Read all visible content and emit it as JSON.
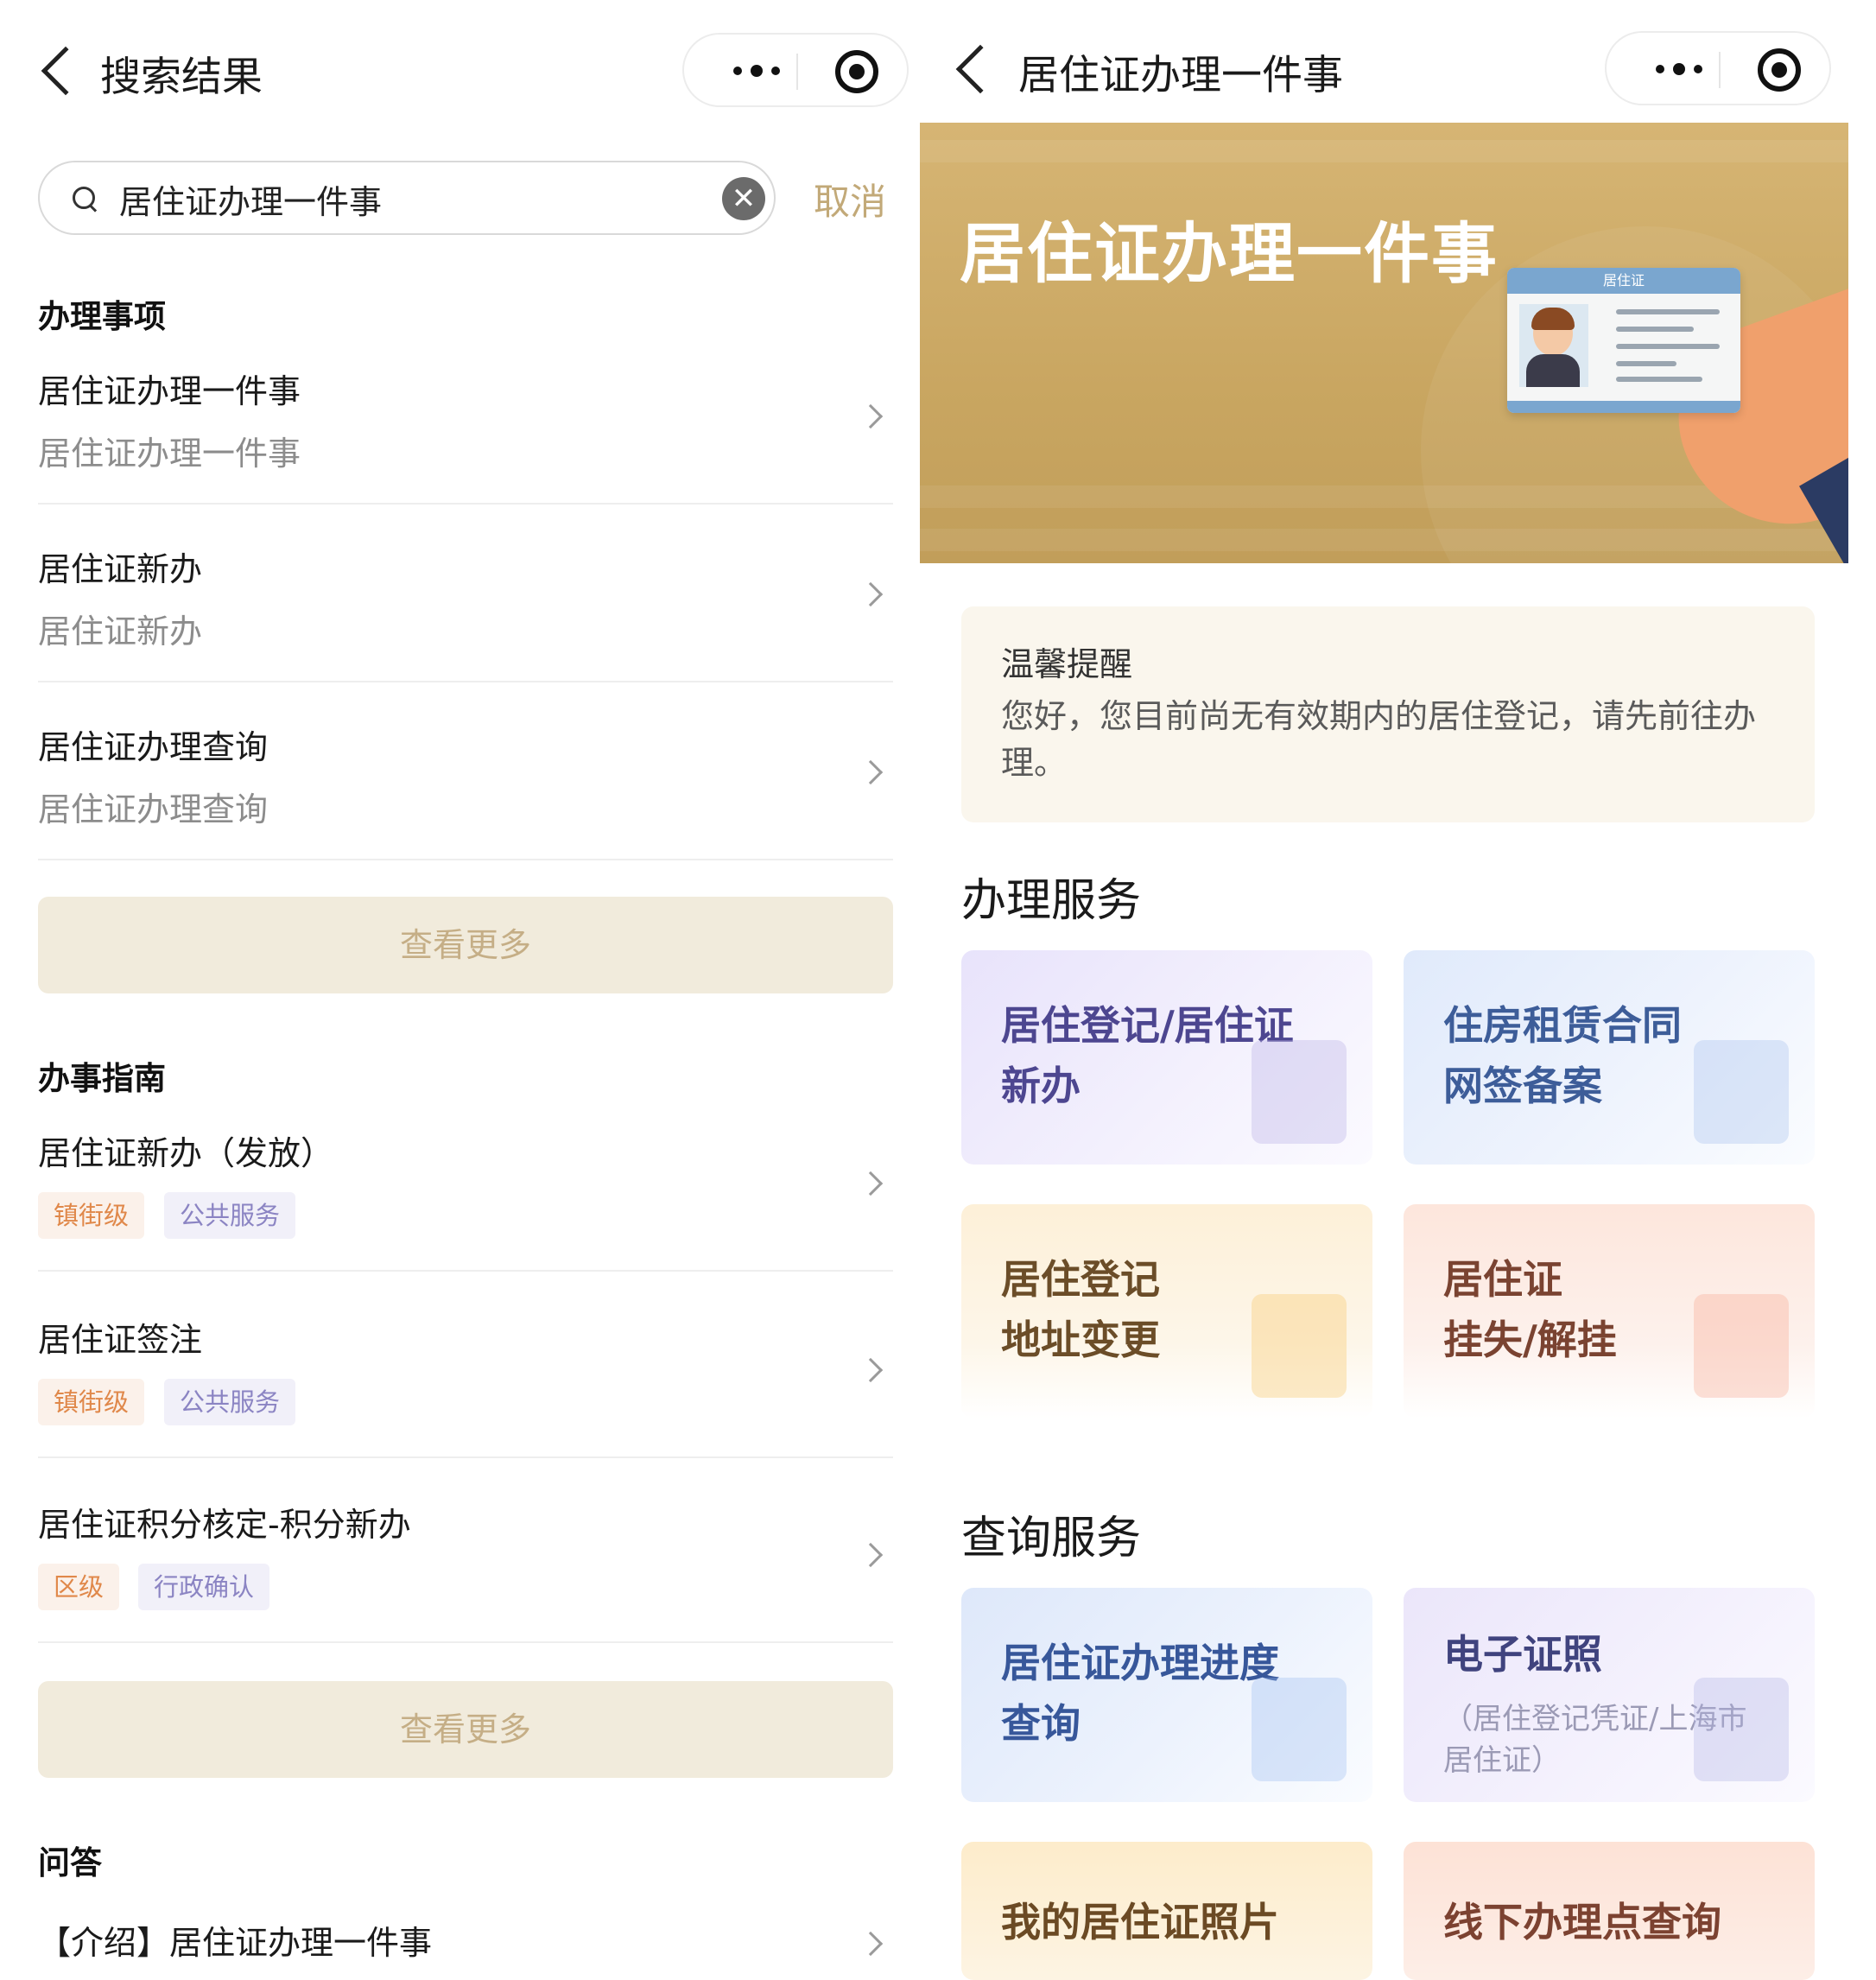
{
  "left": {
    "nav": {
      "title": "搜索结果"
    },
    "search": {
      "value": "居住证办理一件事",
      "cancel": "取消"
    },
    "sections": {
      "items_title": "办理事项",
      "guide_title": "办事指南",
      "qa_title": "问答"
    },
    "items": [
      {
        "title": "居住证办理一件事",
        "subtitle": "居住证办理一件事"
      },
      {
        "title": "居住证新办",
        "subtitle": "居住证新办"
      },
      {
        "title": "居住证办理查询",
        "subtitle": "居住证办理查询"
      }
    ],
    "guides": [
      {
        "title": "居住证新办（发放）",
        "tag1": "镇街级",
        "tag2": "公共服务"
      },
      {
        "title": "居住证签注",
        "tag1": "镇街级",
        "tag2": "公共服务"
      },
      {
        "title": "居住证积分核定-积分新办",
        "tag1": "区级",
        "tag2": "行政确认"
      }
    ],
    "more_label": "查看更多",
    "qa": [
      {
        "title": "【介绍】居住证办理一件事"
      }
    ]
  },
  "right": {
    "nav": {
      "title": "居住证办理一件事"
    },
    "banner": {
      "title": "居住证办理一件事",
      "card_header": "居住证"
    },
    "notice": {
      "title": "温馨提醒",
      "body": "您好，您目前尚无有效期内的居住登记，请先前往办理。"
    },
    "handle_section": "办理服务",
    "query_section": "查询服务",
    "handle_cards": [
      {
        "label": "居住登记/居住证\n新办"
      },
      {
        "label": "住房租赁合同\n网签备案"
      },
      {
        "label": "居住登记\n地址变更"
      },
      {
        "label": "居住证\n挂失/解挂"
      }
    ],
    "query_cards": [
      {
        "label": "居住证办理进度\n查询"
      },
      {
        "label": "电子证照",
        "sub": "（居住登记凭证/上海市\n居住证）"
      },
      {
        "label": "我的居住证照片"
      },
      {
        "label": "线下办理点查询"
      }
    ]
  },
  "colors": {
    "accent_gold": "#c2a978",
    "more_bg": "#f1ebdc",
    "tag_orange": "#e0884a",
    "tag_purple": "#8b84c3",
    "banner_bg": "#c9a661"
  },
  "icons": [
    "back-icon",
    "more-dots-icon",
    "target-icon",
    "search-icon",
    "clear-icon",
    "chevron-right-icon"
  ]
}
